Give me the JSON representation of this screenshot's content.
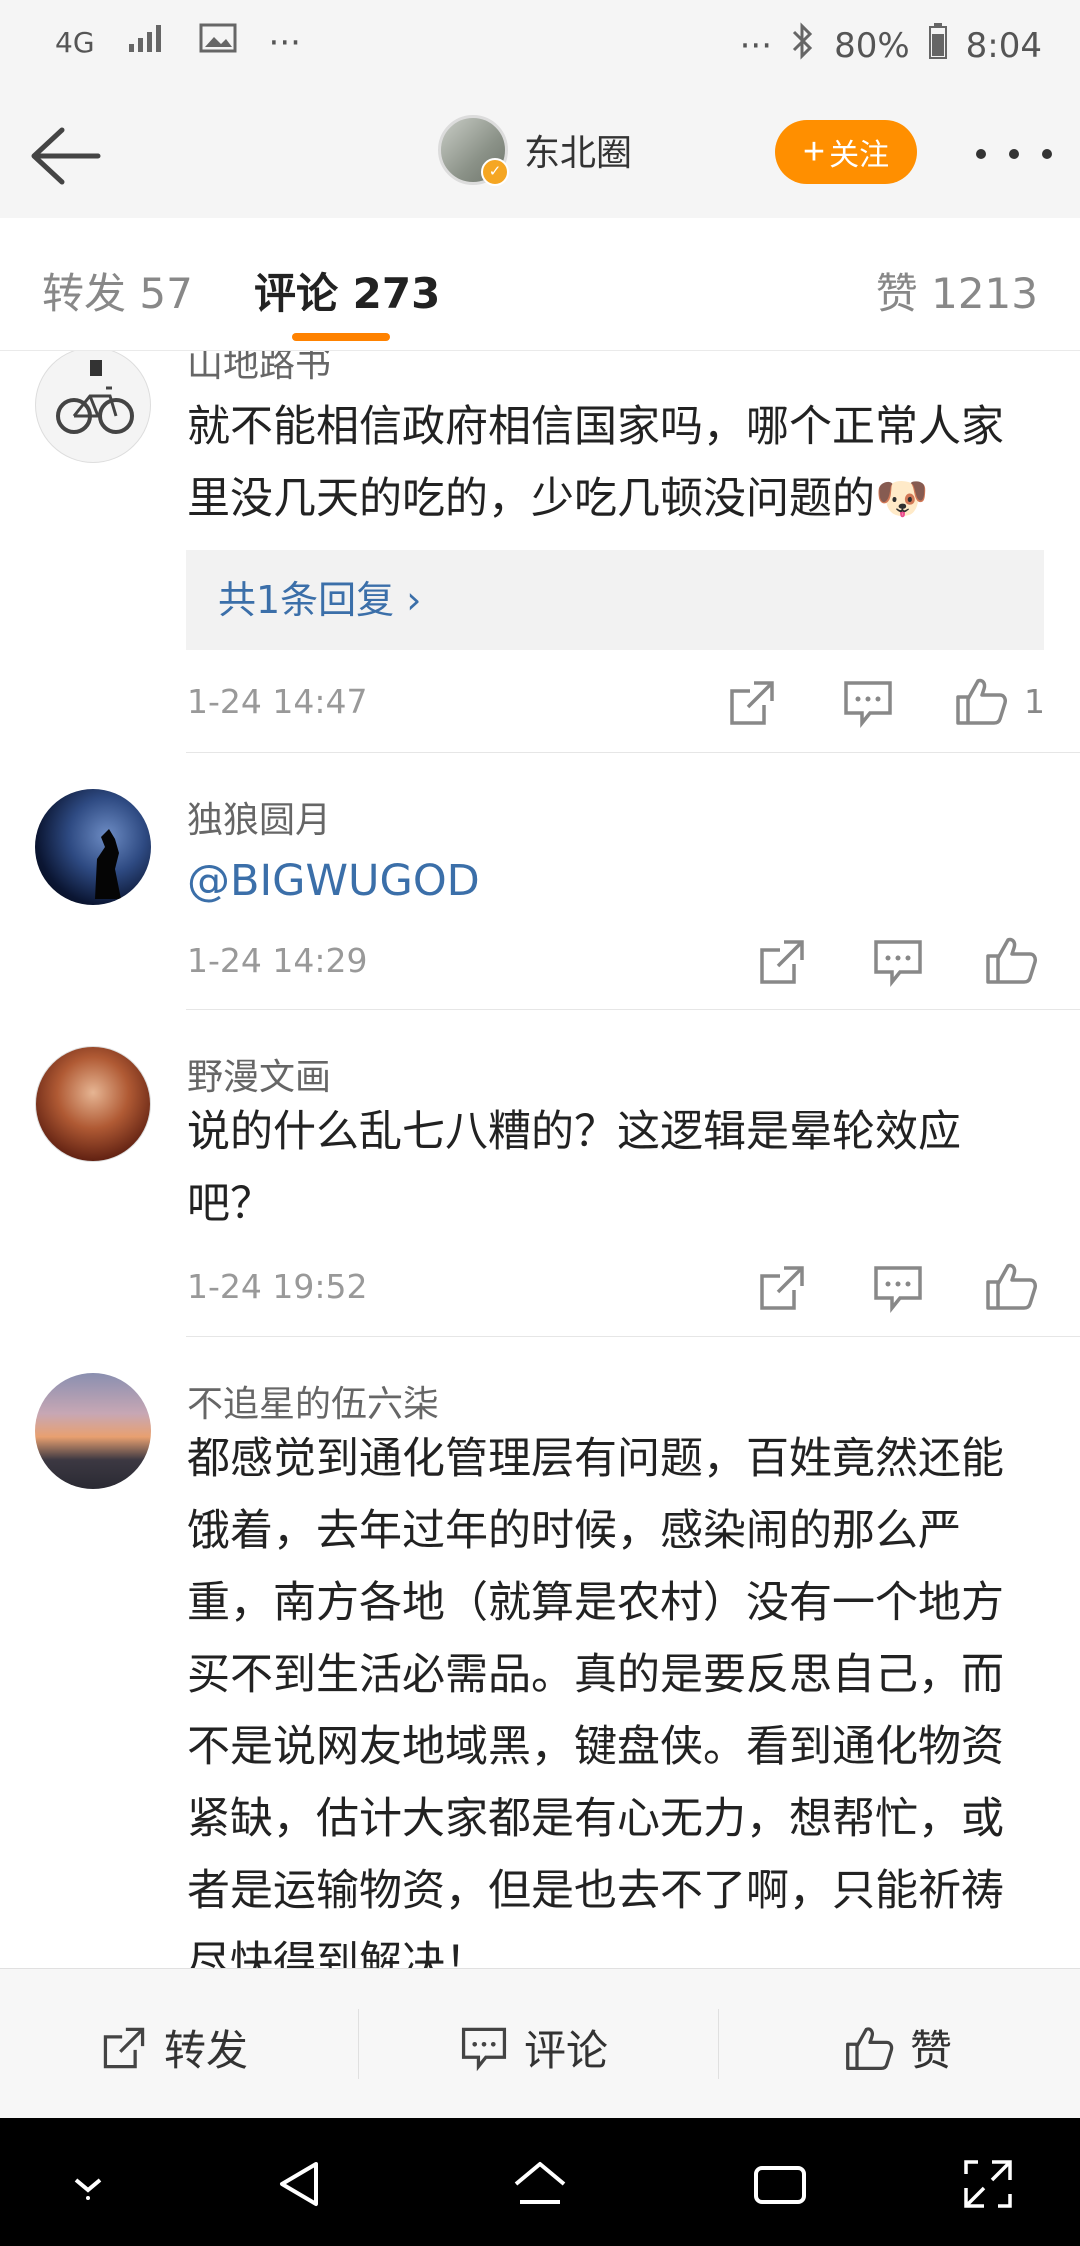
{
  "status_bar": {
    "network": "4G",
    "more": "···",
    "right_more": "···",
    "battery": "80%",
    "time": "8:04"
  },
  "nav": {
    "account_name": "东北圈",
    "follow_label": "关注",
    "follow_plus": "+",
    "accent_color": "#ff8f00"
  },
  "tabs": [
    {
      "label": "转发 57"
    },
    {
      "label": "评论 273"
    },
    {
      "label": "赞 1213"
    }
  ],
  "comments": [
    {
      "name": "山地路书",
      "text": [
        "就不能相信政府相信国家吗，哪个正常人家",
        "里没几天的吃的，少吃几顿没问题的🐶"
      ],
      "replies": "共1条回复 ›",
      "time": "1-24 14:47",
      "likes": "1"
    },
    {
      "name": "独狼圆月",
      "text": [
        "@BIGWUGOD"
      ],
      "time": "1-24 14:29",
      "likes": ""
    },
    {
      "name": "野漫文画",
      "text": [
        "说的什么乱七八糟的？这逻辑是晕轮效应",
        "吧？"
      ],
      "time": "1-24 19:52",
      "likes": ""
    },
    {
      "name": "不追星的伍六柒",
      "text": [
        "都感觉到通化管理层有问题，百姓竟然还能",
        "饿着，去年过年的时候，感染闹的那么严",
        "重，南方各地（就算是农村）没有一个地方",
        "买不到生活必需品。真的是要反思自己，而",
        "不是说网友地域黑，键盘侠。看到通化物资",
        "紧缺，估计大家都是有心无力，想帮忙，或",
        "者是运输物资，但是也去不了啊，只能祈祷",
        "尽快得到解决！"
      ]
    }
  ],
  "bottom_bar": {
    "repost": "转发",
    "comment": "评论",
    "like": "赞"
  }
}
